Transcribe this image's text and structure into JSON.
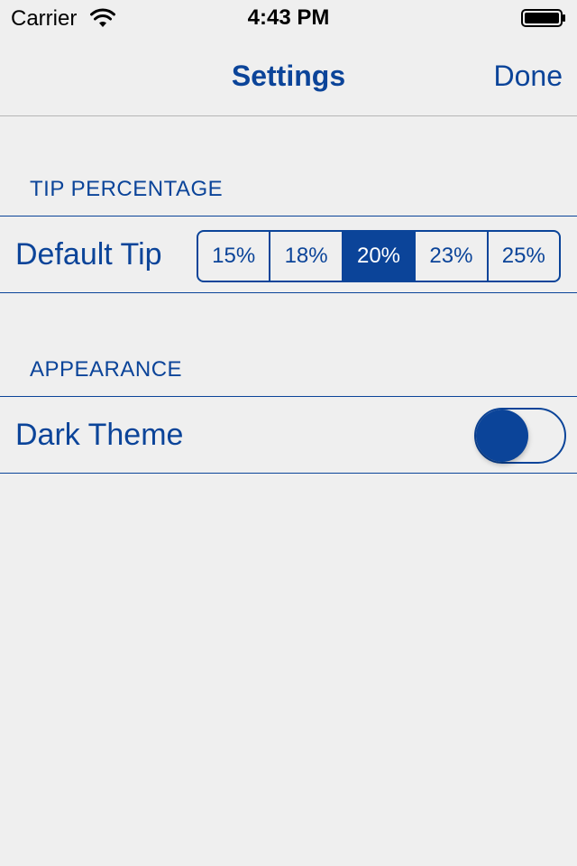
{
  "status_bar": {
    "carrier": "Carrier",
    "time": "4:43 PM",
    "wifi_icon": "wifi-icon",
    "battery_icon": "battery-icon"
  },
  "nav": {
    "title": "Settings",
    "done_label": "Done"
  },
  "sections": {
    "tip": {
      "header": "TIP PERCENTAGE",
      "row_label": "Default Tip",
      "options": [
        "15%",
        "18%",
        "20%",
        "23%",
        "25%"
      ],
      "selected": "20%"
    },
    "appearance": {
      "header": "APPEARANCE",
      "row_label": "Dark Theme",
      "toggle_on": false
    }
  },
  "colors": {
    "accent": "#0b4499",
    "background": "#efefef",
    "separator": "#b5b5b5"
  }
}
